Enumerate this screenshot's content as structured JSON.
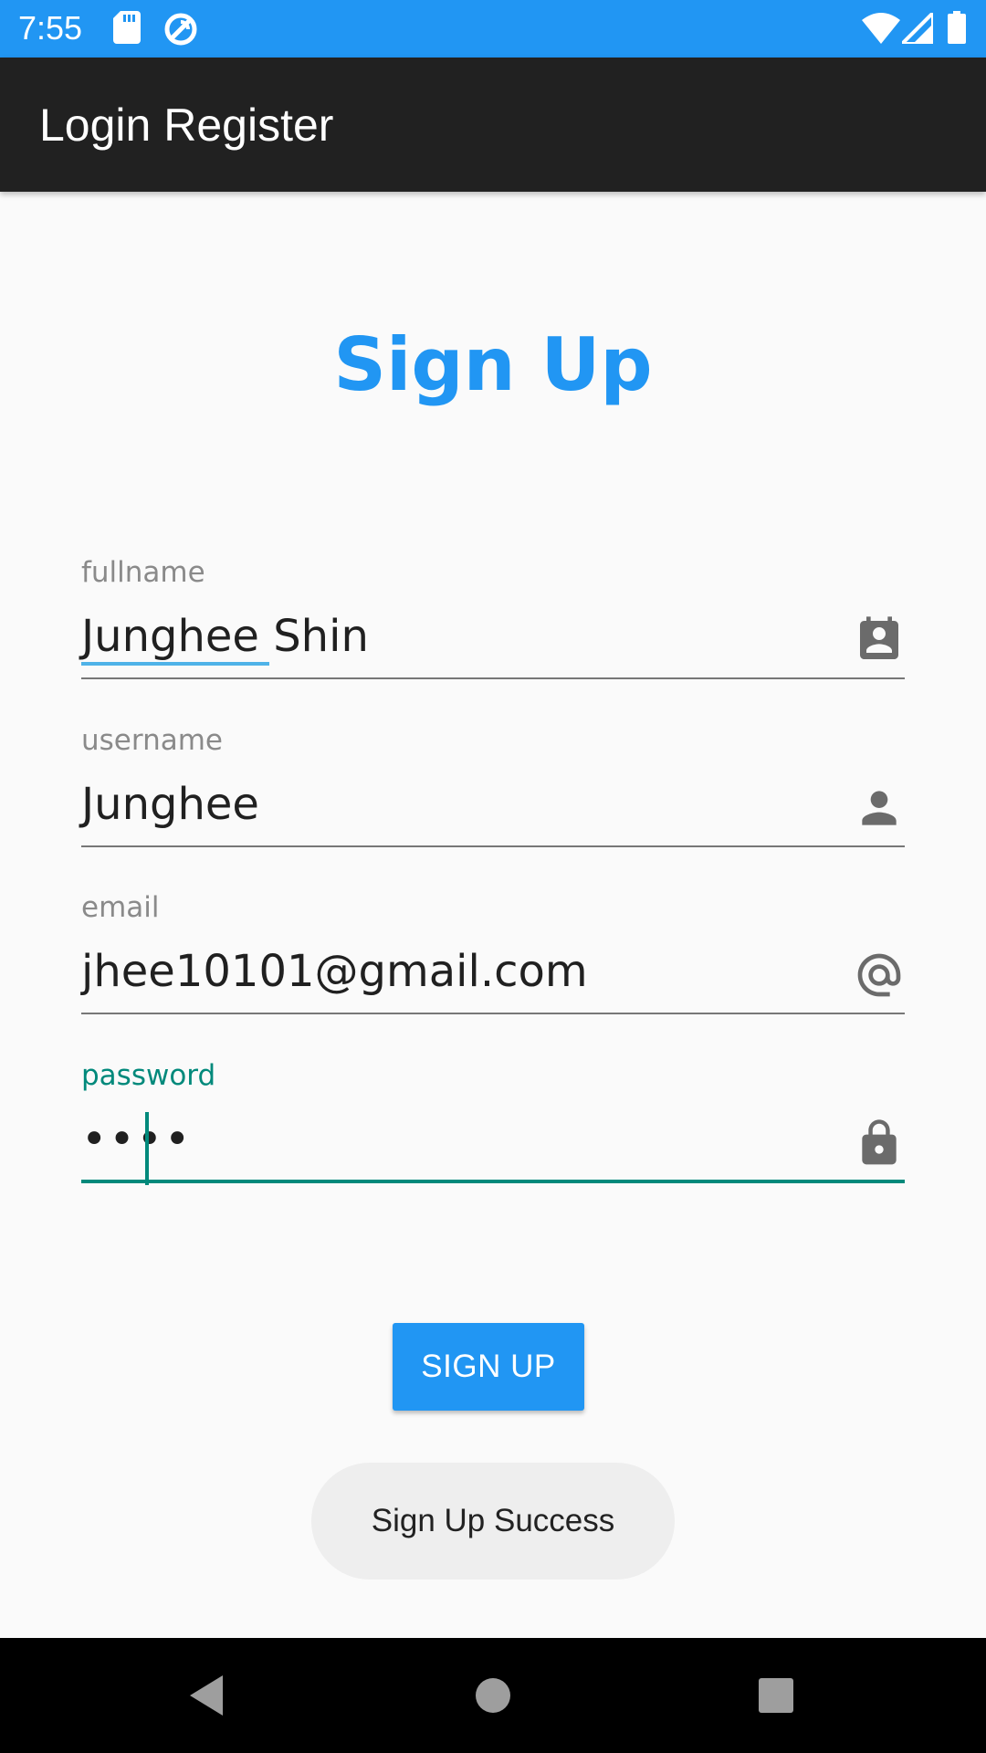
{
  "status_bar": {
    "time": "7:55",
    "background": "#2196f3",
    "icons_left": [
      "sd-card-icon",
      "sync-icon"
    ],
    "icons_right": [
      "wifi-icon",
      "cellular-signal-icon",
      "battery-icon"
    ]
  },
  "app_bar": {
    "title": "Login Register",
    "background": "#212121"
  },
  "heading": {
    "text": "Sign Up",
    "color": "#2196f3"
  },
  "form": {
    "fields": [
      {
        "label": "fullname",
        "value": "Junghee Shin",
        "icon": "contact-card-icon"
      },
      {
        "label": "username",
        "value": "Junghee",
        "icon": "person-icon"
      },
      {
        "label": "email",
        "value": "jhee10101@gmail.com",
        "icon": "at-sign-icon"
      },
      {
        "label": "password",
        "value": "••••",
        "icon": "lock-icon",
        "focused": true
      }
    ],
    "focus_color": "#00897b"
  },
  "signup_button": {
    "label": "SIGN UP",
    "color": "#2196f3"
  },
  "toast": {
    "text": "Sign Up Success"
  },
  "nav_bar": {
    "buttons": [
      "back-icon",
      "home-icon",
      "recents-icon"
    ]
  }
}
